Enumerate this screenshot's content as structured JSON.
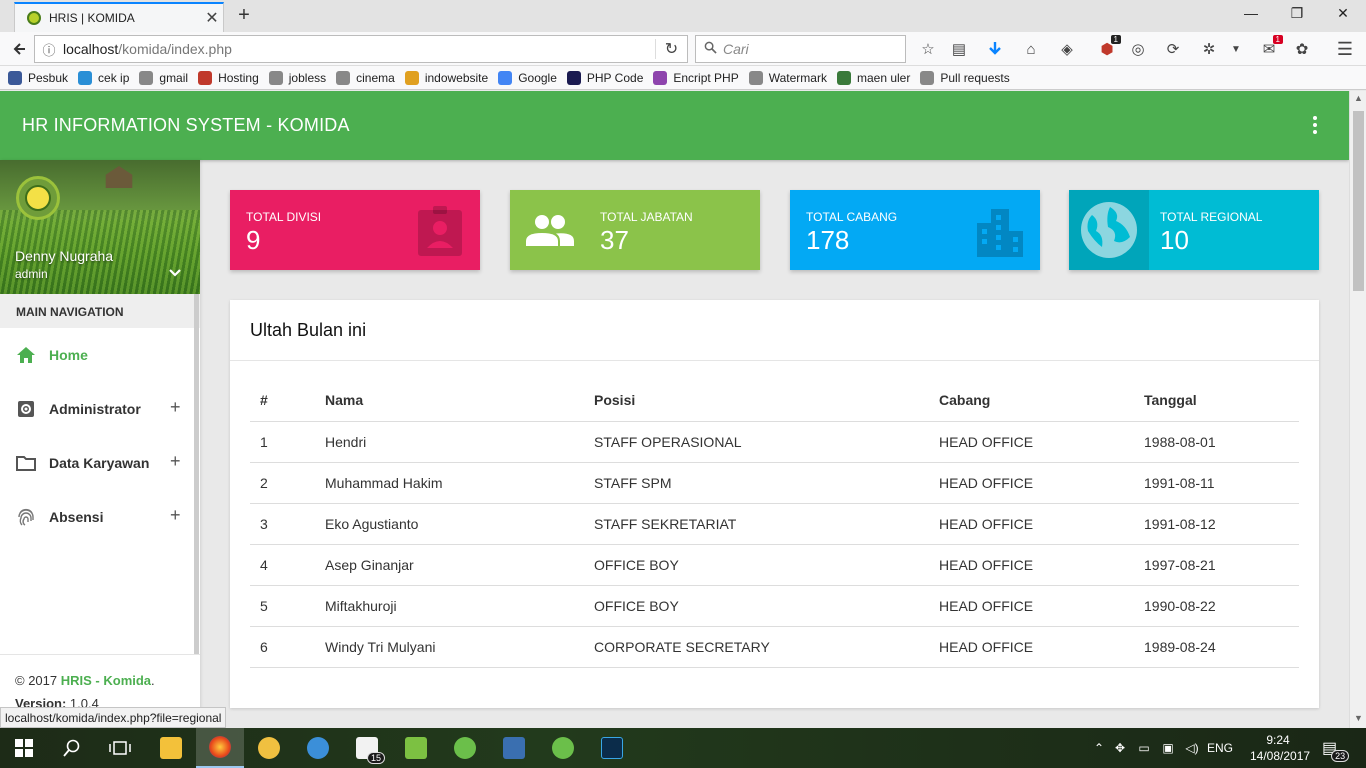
{
  "browser": {
    "tab_title": "HRIS | KOMIDA",
    "url_host": "localhost",
    "url_path": "/komida/index.php",
    "search_placeholder": "Cari",
    "bookmarks": [
      {
        "label": "Pesbuk",
        "color": "#3b5998"
      },
      {
        "label": "cek ip",
        "color": "#2a8fd6"
      },
      {
        "label": "gmail",
        "color": "#888888"
      },
      {
        "label": "Hosting",
        "color": "#c0392b"
      },
      {
        "label": "jobless",
        "color": "#888888"
      },
      {
        "label": "cinema",
        "color": "#888888"
      },
      {
        "label": "indowebsite",
        "color": "#e0a020"
      },
      {
        "label": "Google",
        "color": "#4285f4"
      },
      {
        "label": "PHP Code",
        "color": "#1a1a50"
      },
      {
        "label": "Encript PHP",
        "color": "#8e44ad"
      },
      {
        "label": "Watermark",
        "color": "#888888"
      },
      {
        "label": "maen uler",
        "color": "#3a7a3a"
      },
      {
        "label": "Pull requests",
        "color": "#888888"
      }
    ],
    "toolbar_badge": "1",
    "ext_badge": "1",
    "status_url": "localhost/komida/index.php?file=regional"
  },
  "app": {
    "title": "HR INFORMATION SYSTEM - KOMIDA",
    "accent": "#4caf50"
  },
  "user": {
    "name": "Denny Nugraha",
    "role": "admin"
  },
  "nav": {
    "header": "MAIN NAVIGATION",
    "items": [
      {
        "label": "Home",
        "icon": "home-icon",
        "active": true
      },
      {
        "label": "Administrator",
        "icon": "settings-icon",
        "expand": "+"
      },
      {
        "label": "Data Karyawan",
        "icon": "folder-icon",
        "expand": "+"
      },
      {
        "label": "Absensi",
        "icon": "fingerprint-icon",
        "expand": "+"
      }
    ]
  },
  "footer": {
    "copyright": "© 2017",
    "brand": "HRIS - Komida",
    "period": ".",
    "version_label": "Version:",
    "version": "1.0.4"
  },
  "stats": [
    {
      "label": "TOTAL DIVISI",
      "value": "9",
      "color": "#e91e63",
      "icon": "contact-badge-icon"
    },
    {
      "label": "TOTAL JABATAN",
      "value": "37",
      "color": "#8bc34a",
      "icon": "people-icon"
    },
    {
      "label": "TOTAL CABANG",
      "value": "178",
      "color": "#03a9f4",
      "icon": "building-icon"
    },
    {
      "label": "TOTAL REGIONAL",
      "value": "10",
      "color": "#00bcd4",
      "icon": "globe-icon"
    }
  ],
  "birthdays": {
    "title": "Ultah Bulan ini",
    "columns": [
      "#",
      "Nama",
      "Posisi",
      "Cabang",
      "Tanggal"
    ],
    "rows": [
      [
        "1",
        "Hendri",
        "STAFF OPERASIONAL",
        "HEAD OFFICE",
        "1988-08-01"
      ],
      [
        "2",
        "Muhammad Hakim",
        "STAFF SPM",
        "HEAD OFFICE",
        "1991-08-11"
      ],
      [
        "3",
        "Eko Agustianto",
        "STAFF SEKRETARIAT",
        "HEAD OFFICE",
        "1991-08-12"
      ],
      [
        "4",
        "Asep Ginanjar",
        "OFFICE BOY",
        "HEAD OFFICE",
        "1997-08-21"
      ],
      [
        "5",
        "Miftakhuroji",
        "OFFICE BOY",
        "HEAD OFFICE",
        "1990-08-22"
      ],
      [
        "6",
        "Windy Tri Mulyani",
        "CORPORATE SECRETARY",
        "HEAD OFFICE",
        "1989-08-24"
      ]
    ]
  },
  "taskbar": {
    "mail_badge": "15",
    "lang": "ENG",
    "time": "9:24",
    "date": "14/08/2017",
    "notif_count": "23"
  }
}
